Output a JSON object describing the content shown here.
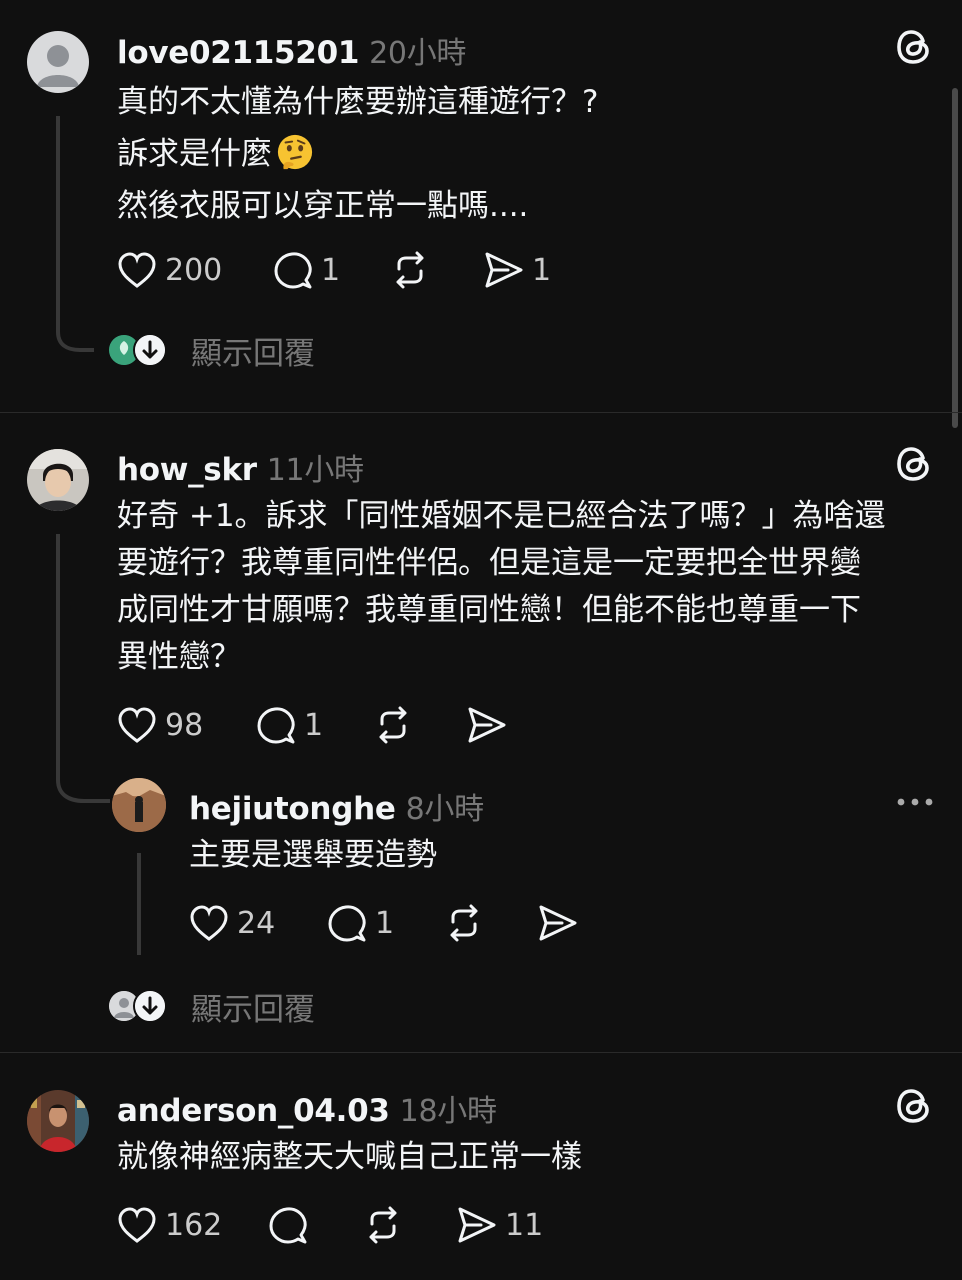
{
  "posts": [
    {
      "username": "love02115201",
      "time": "20小時",
      "lines": [
        "真的不太懂為什麼要辦這種遊行？?",
        "訴求是什麼",
        "然後衣服可以穿正常一點嗎...."
      ],
      "emoji": "thinking-face",
      "likes": "200",
      "comments": "1",
      "shares": "1",
      "show_replies": "顯示回覆"
    },
    {
      "username": "how_skr",
      "time": "11小時",
      "lines": [
        "好奇 +1。訴求「同性婚姻不是已經合法了嗎？」為啥還",
        "要遊行？我尊重同性伴侶。但是這是一定要把全世界變",
        "成同性才甘願嗎？我尊重同性戀！但能不能也尊重一下",
        "異性戀？"
      ],
      "likes": "98",
      "comments": "1",
      "reply": {
        "username": "hejiutonghe",
        "time": "8小時",
        "text": "主要是選舉要造勢",
        "likes": "24",
        "comments": "1"
      },
      "show_replies": "顯示回覆"
    },
    {
      "username": "anderson_04.03",
      "time": "18小時",
      "lines": [
        "就像神經病整天大喊自己正常一樣"
      ],
      "likes": "162",
      "shares": "11"
    }
  ],
  "colors": {
    "background": "#101010",
    "text": "#f3f5f7",
    "muted": "#777777",
    "line": "#383838"
  }
}
